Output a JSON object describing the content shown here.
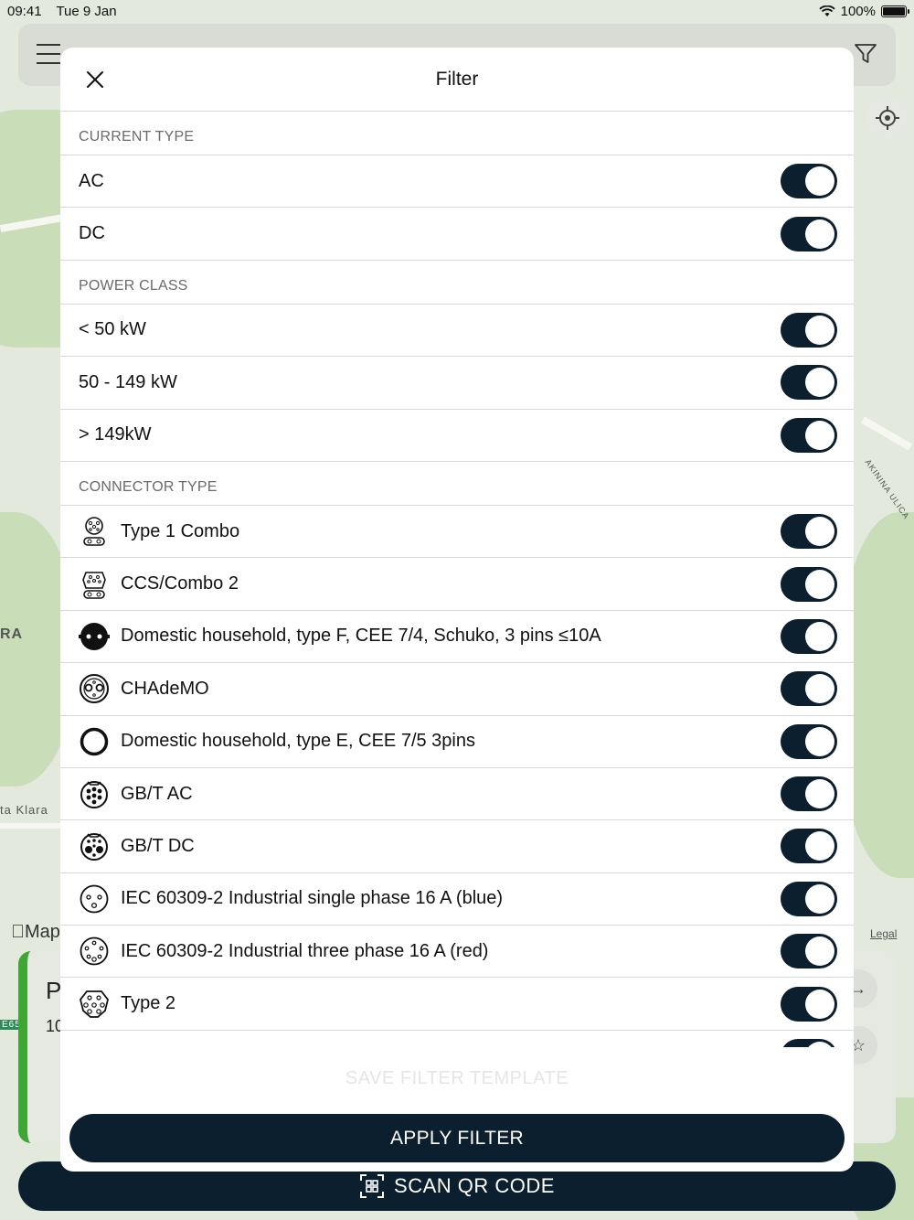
{
  "status": {
    "time": "09:41",
    "date": "Tue 9 Jan",
    "battery": "100%"
  },
  "map": {
    "label_ra": "RA",
    "label_klara": "ta Klara",
    "label_street": "AKININA ULICA",
    "maps_logo": "Maps",
    "legal": "Legal",
    "card_fragment_p": "P",
    "card_fragment_num": "10",
    "road_sign": "E65"
  },
  "scan_bar": {
    "label": "SCAN QR CODE",
    "icon": "qr-code-icon"
  },
  "modal": {
    "title": "Filter",
    "close_icon": "close-icon",
    "sections": {
      "current_type": {
        "header": "CURRENT TYPE",
        "items": [
          {
            "label": "AC",
            "enabled": true
          },
          {
            "label": "DC",
            "enabled": true
          }
        ]
      },
      "power_class": {
        "header": "POWER CLASS",
        "items": [
          {
            "label": "< 50 kW",
            "enabled": true
          },
          {
            "label": "50 - 149 kW",
            "enabled": true
          },
          {
            "label": "> 149kW",
            "enabled": true
          }
        ]
      },
      "connector_type": {
        "header": "CONNECTOR TYPE",
        "items": [
          {
            "label": "Type 1 Combo",
            "icon": "type1-combo-icon",
            "enabled": true
          },
          {
            "label": "CCS/Combo 2",
            "icon": "ccs-combo2-icon",
            "enabled": true
          },
          {
            "label": "Domestic household, type F, CEE 7/4, Schuko, 3 pins ≤10A",
            "icon": "schuko-icon",
            "enabled": true
          },
          {
            "label": "CHAdeMO",
            "icon": "chademo-icon",
            "enabled": true
          },
          {
            "label": "Domestic household, type E, CEE 7/5 3pins",
            "icon": "type-e-icon",
            "enabled": true
          },
          {
            "label": "GB/T AC",
            "icon": "gbt-ac-icon",
            "enabled": true
          },
          {
            "label": "GB/T DC",
            "icon": "gbt-dc-icon",
            "enabled": true
          },
          {
            "label": "IEC 60309-2 Industrial single phase 16 A (blue)",
            "icon": "iec-single-phase-icon",
            "enabled": true
          },
          {
            "label": "IEC 60309-2 Industrial three phase 16 A (red)",
            "icon": "iec-three-phase-icon",
            "enabled": true
          },
          {
            "label": "Type 2",
            "icon": "type2-icon",
            "enabled": true
          }
        ]
      }
    },
    "save_template_label": "SAVE FILTER TEMPLATE",
    "apply_label": "APPLY FILTER"
  },
  "colors": {
    "primary_dark": "#0c1f2e",
    "map_green": "#c9ddb9",
    "card_accent": "#3fa535"
  }
}
